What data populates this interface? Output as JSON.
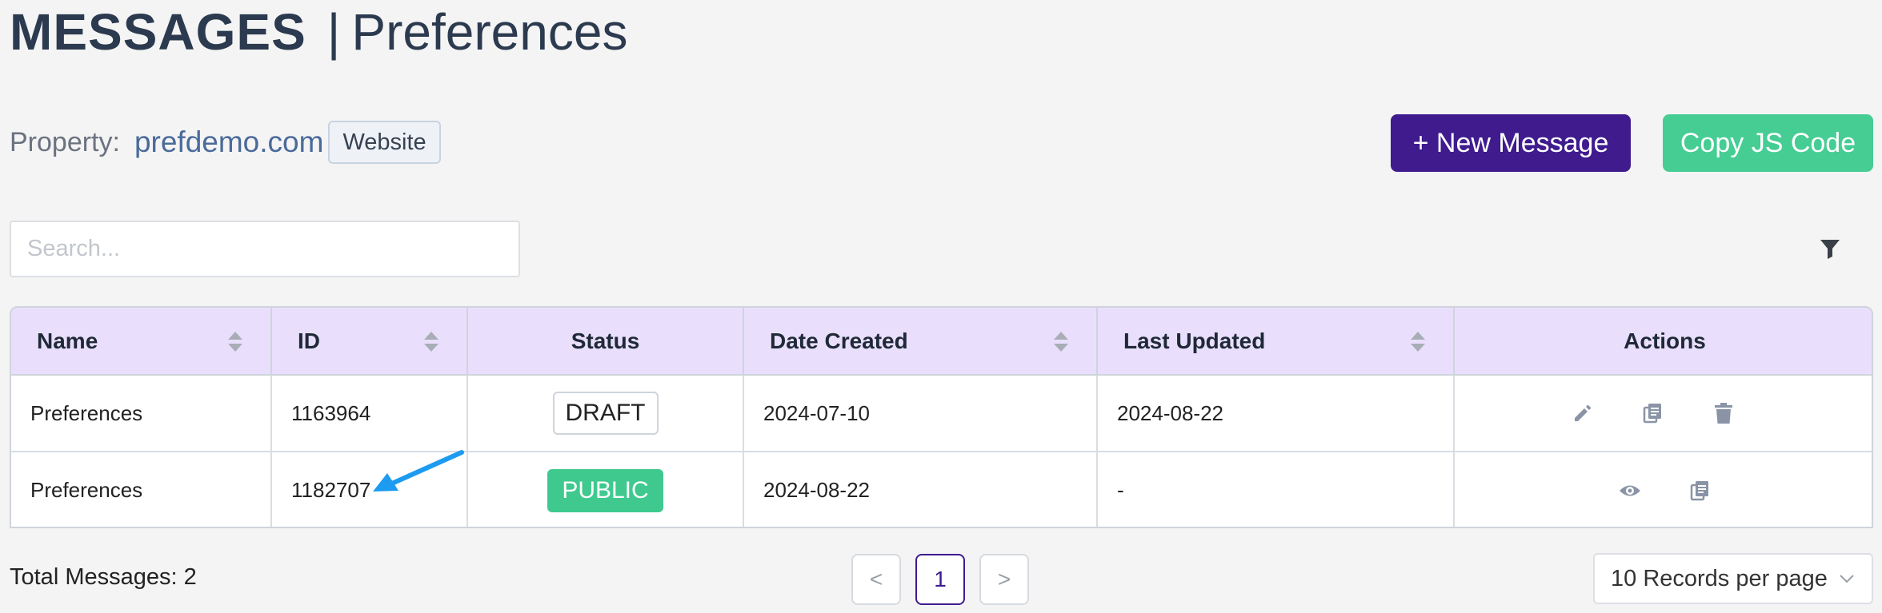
{
  "header": {
    "title": "MESSAGES",
    "separator": "|",
    "subtitle": "Preferences"
  },
  "property": {
    "label": "Property:",
    "value": "prefdemo.com",
    "type_badge": "Website"
  },
  "toolbar": {
    "new_message_label": "+ New Message",
    "copy_js_label": "Copy JS Code"
  },
  "search": {
    "placeholder": "Search...",
    "value": ""
  },
  "table": {
    "columns": [
      "Name",
      "ID",
      "Status",
      "Date Created",
      "Last Updated",
      "Actions"
    ],
    "rows": [
      {
        "name": "Preferences",
        "id": "1163964",
        "status": "DRAFT",
        "date_created": "2024-07-10",
        "last_updated": "2024-08-22",
        "actions": [
          "edit-icon",
          "copy-icon",
          "delete-icon"
        ]
      },
      {
        "name": "Preferences",
        "id": "1182707",
        "status": "PUBLIC",
        "date_created": "2024-08-22",
        "last_updated": "-",
        "actions": [
          "view-icon",
          "copy-icon"
        ]
      }
    ]
  },
  "footer": {
    "total_label": "Total Messages: 2",
    "pagination": {
      "prev": "<",
      "current": "1",
      "next": ">"
    },
    "per_page_label": "10 Records per page"
  },
  "colors": {
    "primary": "#3f1b8e",
    "success": "#45cd94",
    "header_bg": "#e9dffd",
    "annotation_arrow": "#1d9bf0"
  }
}
